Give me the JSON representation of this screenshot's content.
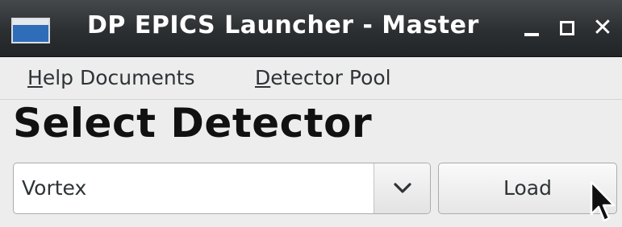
{
  "window": {
    "title": "DP EPICS Launcher - Master",
    "icon": "app-window-icon",
    "controls": {
      "minimize_icon": "minimize-icon",
      "maximize_icon": "maximize-icon",
      "close_glyph": "✕"
    }
  },
  "menubar": {
    "items": [
      {
        "mnemonic": "H",
        "rest": "elp Documents"
      },
      {
        "mnemonic": "D",
        "rest": "etector Pool"
      }
    ]
  },
  "main": {
    "heading": "Select Detector",
    "detector_select": {
      "value": "Vortex",
      "arrow_icon": "chevron-down-icon"
    },
    "load_button": {
      "label": "Load"
    }
  },
  "colors": {
    "titlebar": "#2c2f32",
    "window_bg": "#ededed",
    "text": "#2e3436"
  }
}
